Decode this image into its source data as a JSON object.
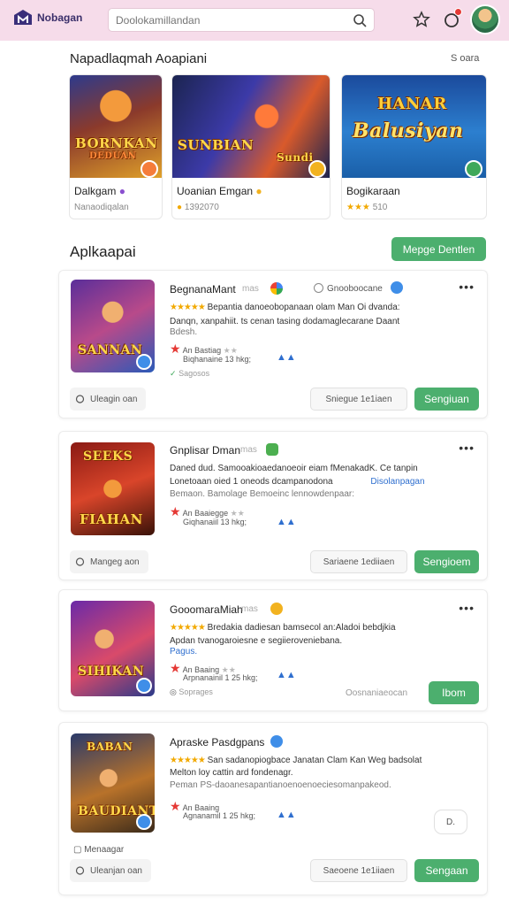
{
  "header": {
    "logo_text": "Nobagan",
    "search_placeholder": "Doolokamillandan"
  },
  "featured": {
    "title": "Napadlaqmah Aoapiani",
    "see_all": "S oara",
    "items": [
      {
        "name": "Dalkgam",
        "sub": "Nanaodiqalan",
        "art_title": "BORNKAN",
        "art_sub": "DEDUAN"
      },
      {
        "name": "Uoanian Emgan",
        "sub": "1392070",
        "art_title": "SUNBIAN",
        "art_sub": "Sundi"
      },
      {
        "name": "Bogikaraan",
        "sub": "510",
        "art_title": "HANAR",
        "art_sub": "Balusiyan"
      }
    ]
  },
  "apps": {
    "title": "Aplkaapai",
    "header_button": "Mepge Dentlen",
    "cards": [
      {
        "name": "BegnanaMant",
        "meta": "mas",
        "extra": "Gnooboocane",
        "line1": "Bepantia danoeobopanaan olam Man Oi dvanda:",
        "line2": "Danqn, xanpahiit. ts cenan tasing dodamaglecarane Daant",
        "line3": "Bdesh.",
        "rating_label": "An Bastiag",
        "sub_label": "Biqhanaine 13 hkg;",
        "small_extra": "Sagosos",
        "chip": "Uleagin oan",
        "grey_btn": "Sniegue 1e1iaen",
        "green_btn": "Sengiuan",
        "art_title": "SANNAN"
      },
      {
        "name": "Gnplisar Dman",
        "meta": "mas",
        "line1": "Daned dud. Samooakioaedanoeoir eiam fMenakadK. Ce tanpin",
        "line2": "Lonetoaan oied 1 oneods dcampanodona",
        "line2_link": "Disolanpagan",
        "line3": "Bemaon. Bamolage Bemoeinc lennowdenpaar:",
        "rating_label": "An Baaiegge",
        "sub_label": "Giqhanaiil 13 hkg;",
        "chip": "Mangeg aon",
        "grey_btn": "Sariaene 1ediiaen",
        "green_btn": "Sengioem",
        "art_title": "FIAHAN",
        "art_top": "SEEKS"
      },
      {
        "name": "GooomaraMiah",
        "meta": "mas",
        "line1": "Bredakia dadiesan bamsecol an:Aladoi bebdjkia",
        "line2": "Apdan tvanogaroiesne e segiieroveniebana.",
        "line3": "Pagus.",
        "rating_label": "An Baaing",
        "sub_label": "Arpnanainil 1 25 hkg;",
        "small_extra": "Soprages",
        "grey_text": "Oosnaniaeocan",
        "green_btn": "Ibom",
        "art_title": "SIHIKAN"
      },
      {
        "name": "Apraske Pasdgpans",
        "line1": "San sadanopiogbace Janatan Clam Kan Weg badsolat",
        "line2": "Melton loy cattin ard fondenagr.",
        "line3": "Peman PS-daoanesapantianoenoenoeciesomanpakeod.",
        "rating_label": "An Baaing",
        "sub_label": "Agnanamil 1 25 hkg;",
        "chip_top": "Menaagar",
        "chip": "Uleanjan oan",
        "box_btn": "D.",
        "grey_btn": "Saeoene 1e1iiaen",
        "green_btn": "Sengaan",
        "art_title": "BAUDIANT",
        "art_top": "BABAN"
      }
    ]
  },
  "colors": {
    "accent_green": "#4caf6e",
    "header_pink": "#f6dcea",
    "link_blue": "#2f6fcf",
    "star_yellow": "#f2a900"
  }
}
